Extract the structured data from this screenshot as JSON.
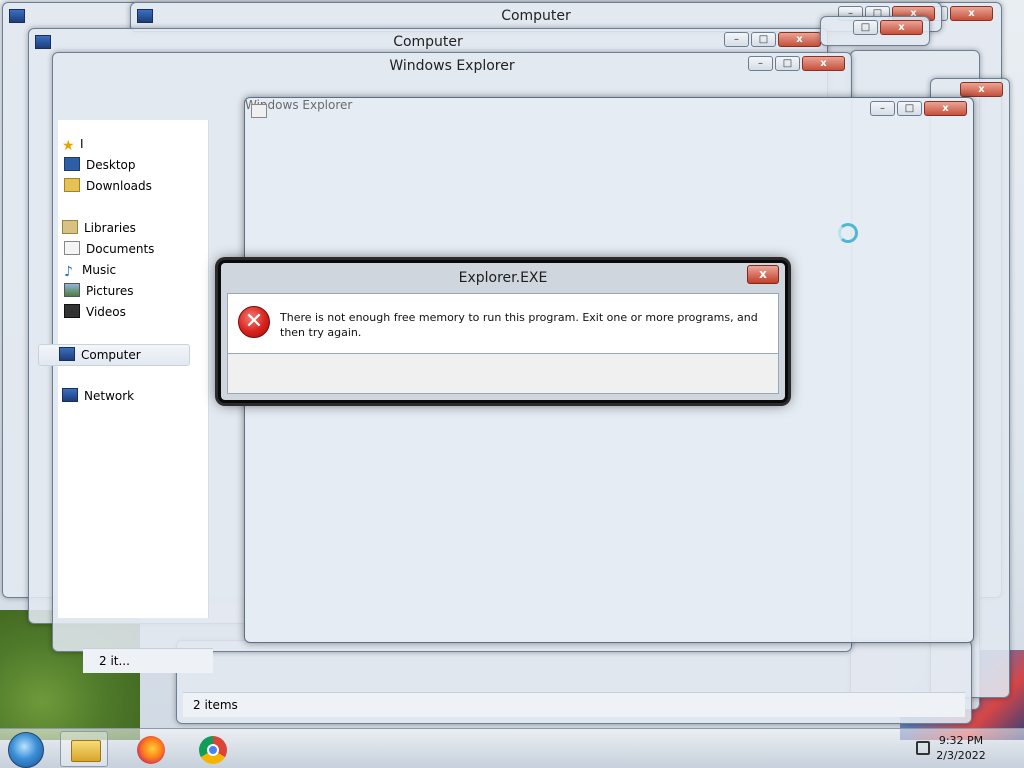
{
  "ghost_windows": {
    "w1_title": "Computer",
    "w2_title": "Computer",
    "w3_title": "Windows Explorer",
    "w3_status": "2 it...",
    "back_status": "2 items"
  },
  "front_window": {
    "title": "Windows Explorer"
  },
  "nav": {
    "favorites_label": "I",
    "items": [
      {
        "label": "Desktop"
      },
      {
        "label": "Downloads"
      },
      {
        "label": "Libraries"
      },
      {
        "label": "Documents"
      },
      {
        "label": "Music"
      },
      {
        "label": "Pictures"
      },
      {
        "label": "Videos"
      },
      {
        "label": "Computer"
      },
      {
        "label": "Network"
      }
    ]
  },
  "dialog": {
    "title": "Explorer.EXE",
    "message": "There is not enough free memory to run this program. Exit one or more programs, and then try again.",
    "close_glyph": "x",
    "icon": "error-x-icon"
  },
  "controls": {
    "minimize": "–",
    "maximize": "□",
    "close": "x"
  },
  "taskbar": {
    "time": "9:32 PM",
    "date": "2/3/2022",
    "icons": [
      "start-orb",
      "file-explorer",
      "firefox",
      "chrome",
      "network-tray"
    ]
  },
  "colors": {
    "error_red": "#d9211c",
    "close_red": "#c7503a",
    "accent_blue": "#3b8fd6"
  }
}
